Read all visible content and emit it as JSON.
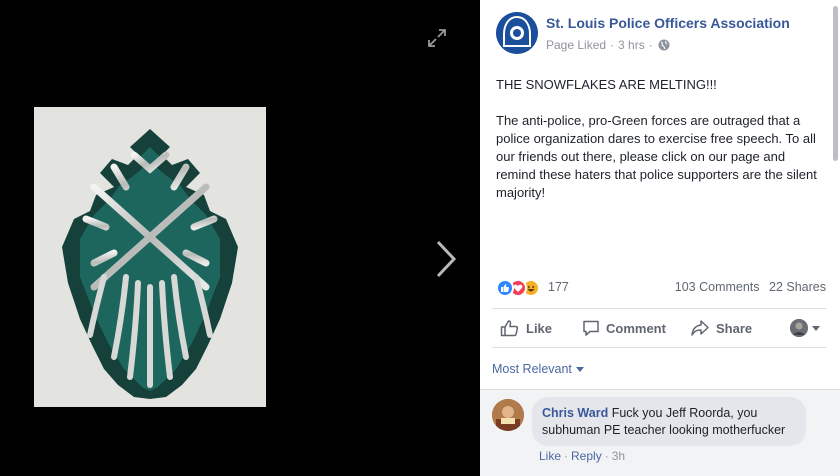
{
  "viewer": {
    "expand_icon": "expand-icon",
    "next_icon": "chevron-right-icon",
    "photo_description_icon": "snowflake-art-icon"
  },
  "post": {
    "page_name": "St. Louis Police Officers Association",
    "page_liked": "Page Liked",
    "time": "3 hrs",
    "audience_icon": "globe-icon",
    "headline": "THE SNOWFLAKES ARE MELTING!!!",
    "body": "The anti-police, pro-Green forces are outraged that a police organization dares to exercise free speech. To all our friends out there, please click on our page and remind these haters that police supporters are the silent majority!"
  },
  "engagement": {
    "reaction_icons": [
      "like-icon",
      "love-icon",
      "haha-icon"
    ],
    "reaction_count": "177",
    "comments": "103 Comments",
    "shares": "22 Shares"
  },
  "actions": {
    "like": "Like",
    "comment": "Comment",
    "share": "Share"
  },
  "comments_section": {
    "sort_label": "Most Relevant",
    "items": [
      {
        "author": "Chris Ward",
        "text": "Fuck you Jeff Roorda, you subhuman PE teacher looking motherfucker",
        "like": "Like",
        "reply": "Reply",
        "time": "3h"
      }
    ]
  },
  "colors": {
    "link_blue": "#385898",
    "text": "#1d2129",
    "muted": "#606770",
    "viewer_bg": "#000000"
  }
}
